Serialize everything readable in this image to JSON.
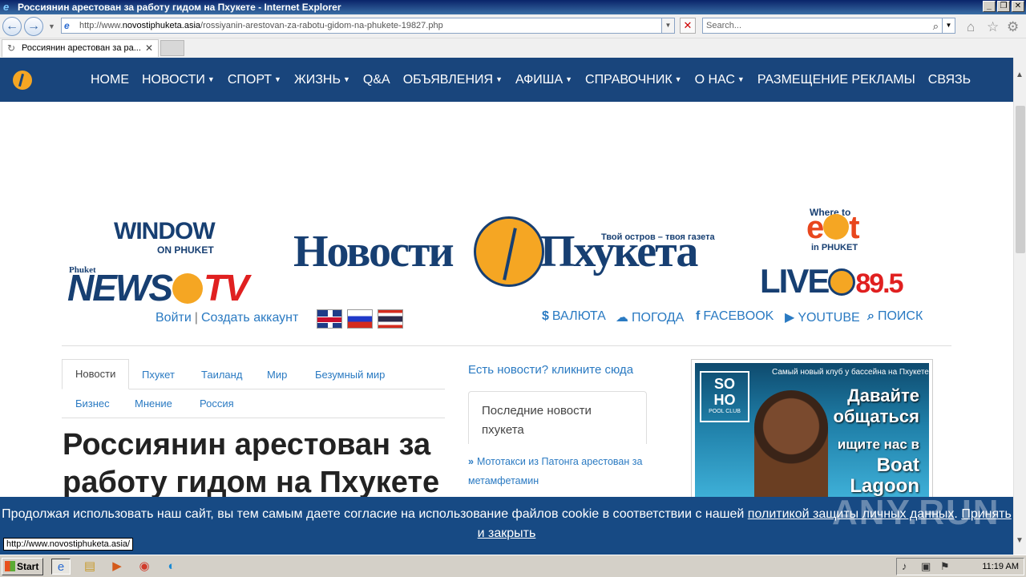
{
  "window": {
    "title": "Россиянин арестован за работу гидом на Пхукете - Internet Explorer",
    "minimize": "_",
    "restore": "❐",
    "close": "✕"
  },
  "browser": {
    "address_prefix": "http://www.",
    "address_host": "novostiphuketa.asia",
    "address_path": "/rossiyanin-arestovan-za-rabotu-gidom-na-phukete-19827.php",
    "search_placeholder": "Search...",
    "tab_title": "Россиянин арестован за ра...",
    "tab_close": "✕",
    "status_url": "http://www.novostiphuketa.asia/"
  },
  "site_nav": {
    "items": [
      {
        "label": "HOME",
        "caret": false
      },
      {
        "label": "НОВОСТИ",
        "caret": true
      },
      {
        "label": "СПОРТ",
        "caret": true
      },
      {
        "label": "ЖИЗНЬ",
        "caret": true
      },
      {
        "label": "Q&A",
        "caret": false
      },
      {
        "label": "ОБЪЯВЛЕНИЯ",
        "caret": true
      },
      {
        "label": "АФИША",
        "caret": true
      },
      {
        "label": "СПРАВОЧНИК",
        "caret": true
      },
      {
        "label": "О НАС",
        "caret": true
      },
      {
        "label": "РАЗМЕЩЕНИЕ РЕКЛАМЫ",
        "caret": false
      },
      {
        "label": "СВЯЗЬ",
        "caret": false
      }
    ]
  },
  "brands": {
    "window_title": "WINDOW",
    "window_sub": "ON PHUKET",
    "newstv_small": "Phuket",
    "newstv_news": "NEWS",
    "newstv_tv": "TV",
    "main_left": "Новости",
    "main_right": "Пхукета",
    "main_tagline": "Твой остров – твоя газета",
    "where_to": "Where to",
    "eat_e": "e",
    "eat_t": "t",
    "eat_sub": "in PHUKET",
    "live": "LIVE",
    "live_fm": "89.5"
  },
  "account": {
    "login": "Войти",
    "separator": "|",
    "register": "Создать аккаунт"
  },
  "utility_links": [
    {
      "icon": "$",
      "label": "ВАЛЮТА",
      "icon_name": "dollar-icon"
    },
    {
      "icon": "☁",
      "label": "ПОГОДА",
      "icon_name": "weather-icon"
    },
    {
      "icon": "f",
      "label": "FACEBOOK",
      "icon_name": "facebook-icon"
    },
    {
      "icon": "▶",
      "label": "YOUTUBE",
      "icon_name": "youtube-icon"
    },
    {
      "icon": "⌕",
      "label": "ПОИСК",
      "icon_name": "search-icon"
    }
  ],
  "category_tabs": [
    "Новости",
    "Пхукет",
    "Таиланд",
    "Мир",
    "Безумный мир",
    "Бизнес",
    "Мнение",
    "Россия"
  ],
  "article": {
    "title": "Россиянин арестован за работу гидом на Пхукете"
  },
  "sidebar": {
    "have_news": "Есть новости? кликните сюда",
    "latest_title": "Последние новости пхукета",
    "latest_chevron": "»",
    "latest_item": "Мототакси из Патонга арестован за метамфетамин"
  },
  "ad": {
    "top_text": "Самый новый клуб у бассейна на Пхукете",
    "soho_1": "SO",
    "soho_2": "HO",
    "soho_sub": "POOL CLUB",
    "line1": "Давайте",
    "line2": "общаться",
    "line3": "ищите нас в",
    "line4": "Boat",
    "line5": "Lagoon"
  },
  "cookie": {
    "text": "Продолжая использовать наш сайт, вы тем самым даете согласие на использование файлов cookie в соответствии с нашей ",
    "policy_link": "политикой защиты личных данных",
    "dot": ".",
    "accept": "Принять и закрыть"
  },
  "watermark": "ANY.RUN",
  "taskbar": {
    "start": "Start",
    "clock": "11:19 AM"
  },
  "colors": {
    "nav_bg": "#19457c",
    "link": "#2a7ac2",
    "cookie_bg": "#174a84",
    "brand_orange": "#f5a623"
  }
}
